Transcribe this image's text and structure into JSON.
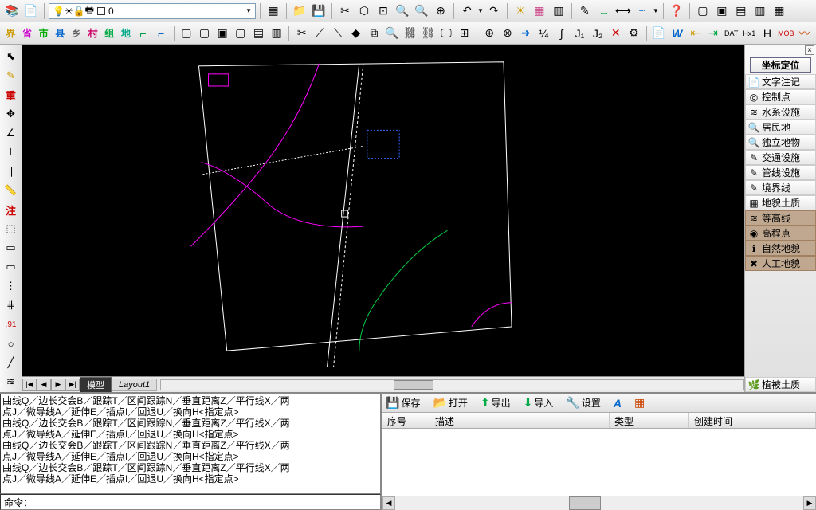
{
  "layer_dropdown": {
    "drop_arrow": "▼",
    "layer_name": "0"
  },
  "char_row": {
    "jie": "界",
    "sheng": "省",
    "shi": "市",
    "xian": "县",
    "xiang": "乡",
    "cun": "村",
    "zu": "组",
    "di": "地"
  },
  "left_tools": {
    "zhong": "重",
    "zhu": "注",
    "num": ".91"
  },
  "canvas_tabs": {
    "nav_first": "|◀",
    "nav_prev": "◀",
    "nav_next": "▶",
    "nav_last": "▶|",
    "active": "模型",
    "inactive": "Layout1"
  },
  "right_panel": {
    "loc": "坐标定位",
    "items": [
      {
        "k": "text_note",
        "label": "文字注记",
        "icon": "📄"
      },
      {
        "k": "ctrl_pt",
        "label": "控制点",
        "icon": "◎"
      },
      {
        "k": "water",
        "label": "水系设施",
        "icon": "≋"
      },
      {
        "k": "residence",
        "label": "居民地",
        "icon": "🔍"
      },
      {
        "k": "indep",
        "label": "独立地物",
        "icon": "🔍"
      },
      {
        "k": "traffic",
        "label": "交通设施",
        "icon": "✎"
      },
      {
        "k": "pipeline",
        "label": "管线设施",
        "icon": "✎"
      },
      {
        "k": "boundary",
        "label": "境界线",
        "icon": "✎"
      },
      {
        "k": "geomorph",
        "label": "地貌土质",
        "icon": "▦"
      }
    ],
    "subs": [
      {
        "k": "contour",
        "label": "等高线",
        "icon": "≋"
      },
      {
        "k": "elev",
        "label": "高程点",
        "icon": "◉"
      },
      {
        "k": "natural",
        "label": "自然地貌",
        "icon": "ℹ"
      },
      {
        "k": "artificial",
        "label": "人工地貌",
        "icon": "✖"
      }
    ],
    "veg": "植被土质"
  },
  "cmd_log": [
    "曲线Q／边长交会B／跟踪T／区间跟踪N／垂直距离Z／平行线X／两",
    "点J／微导线A／延伸E／插点I／回退U／换向H<指定点>",
    "曲线Q／边长交会B／跟踪T／区间跟踪N／垂直距离Z／平行线X／两",
    "点J／微导线A／延伸E／插点I／回退U／换向H<指定点>",
    "曲线Q／边长交会B／跟踪T／区间跟踪N／垂直距离Z／平行线X／两",
    "点J／微导线A／延伸E／插点I／回退U／换向H<指定点>",
    "曲线Q／边长交会B／跟踪T／区间跟踪N／垂直距离Z／平行线X／两",
    "点J／微导线A／延伸E／插点I／回退U／换向H<指定点>"
  ],
  "cmd_prompt": "命令：",
  "props": {
    "save": "保存",
    "open": "打开",
    "export": "导出",
    "import": "导入",
    "settings": "设置",
    "col_seq": "序号",
    "col_desc": "描述",
    "col_type": "类型",
    "col_time": "创建时间"
  }
}
